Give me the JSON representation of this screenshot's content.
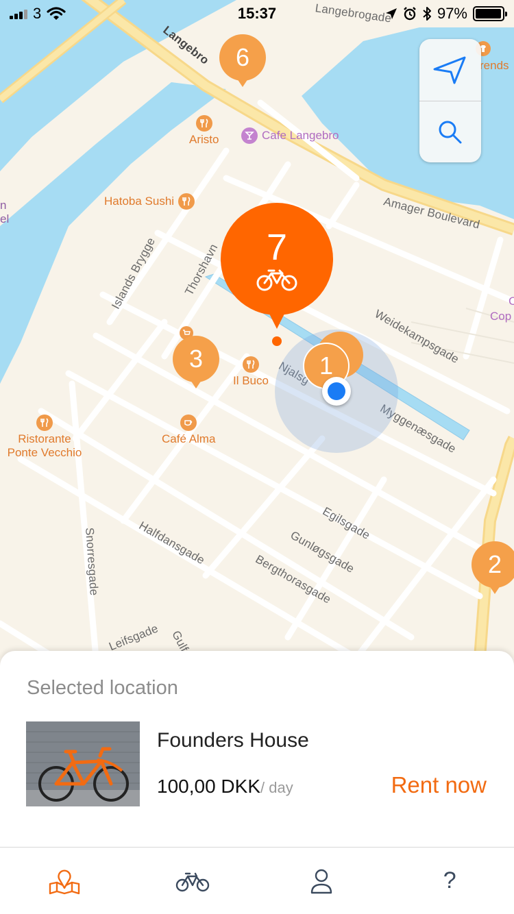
{
  "status_bar": {
    "carrier": "3",
    "time": "15:37",
    "battery_percent": "97%",
    "battery_level": 0.97
  },
  "map": {
    "street_labels": [
      "Langebro",
      "Langebrogade",
      "Amager Boulevard",
      "Islands Brygge",
      "Thorshavn",
      "Weidekampsgade",
      "Njalsg",
      "Myggenæsgade",
      "Egilsgade",
      "Gunløgsgade",
      "Bergthorasgade",
      "Halfdansgade",
      "Snorresgade",
      "Leifsgade",
      "Gulfo"
    ],
    "pois": {
      "aristo": "Aristo",
      "cafe_langebro": "Cafe Langebro",
      "hatoba_sushi": "Hatoba Sushi",
      "il_buco": "Il Buco",
      "cafe_alma": "Café Alma",
      "ristorante": "Ristorante",
      "ponte_vecchio": "Ponte Vecchio",
      "trends_partial": "rends",
      "left_partial_1": "n",
      "left_partial_2": "el",
      "right_partial_1": "C",
      "right_partial_2": "Cop"
    },
    "clusters": {
      "c6": "6",
      "c3": "3",
      "c1": "1",
      "c2": "2",
      "selected": "7"
    },
    "controls": {
      "locate_icon": "location-arrow-icon",
      "search_icon": "search-icon"
    },
    "colors": {
      "water": "#a6dcf3",
      "cluster": "#f5a04a",
      "selected_cluster": "#ff6600",
      "user_location": "#1a7cf5"
    }
  },
  "selected_location": {
    "header": "Selected location",
    "name": "Founders House",
    "price": "100,00 DKK",
    "price_unit": "/ day",
    "rent_label": "Rent now",
    "accent_color": "#f26b12"
  },
  "tab_bar": {
    "tabs": [
      "map-icon",
      "bike-icon",
      "profile-icon",
      "help-icon"
    ],
    "active": "map-icon",
    "help_glyph": "?"
  }
}
